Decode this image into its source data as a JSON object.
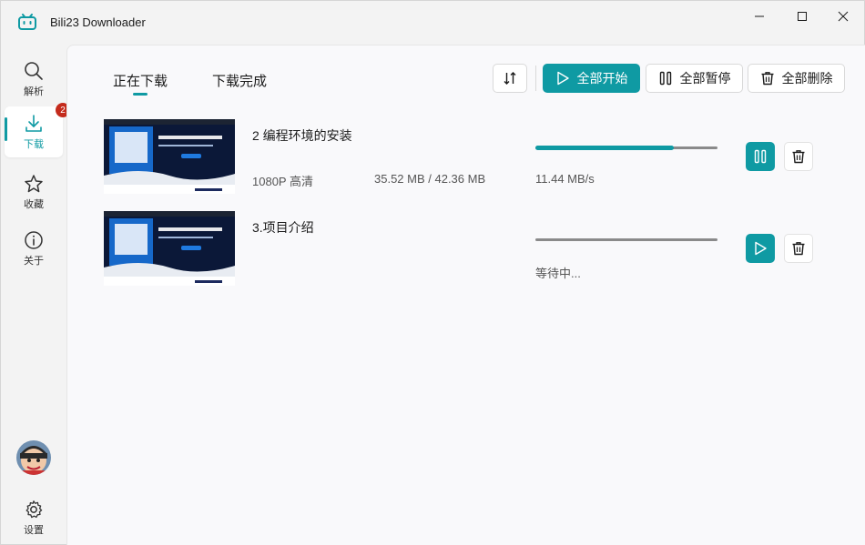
{
  "app": {
    "title": "Bili23 Downloader"
  },
  "window_controls": {
    "minimize": "minimize-icon",
    "maximize": "maximize-icon",
    "close": "close-icon"
  },
  "sidebar": {
    "items": [
      {
        "label": "解析",
        "icon": "search-icon"
      },
      {
        "label": "下载",
        "icon": "download-icon",
        "badge": "2"
      },
      {
        "label": "收藏",
        "icon": "star-icon"
      },
      {
        "label": "关于",
        "icon": "info-icon"
      }
    ],
    "settings_label": "设置"
  },
  "tabs": [
    {
      "label": "正在下载",
      "active": true
    },
    {
      "label": "下载完成",
      "active": false
    }
  ],
  "toolbar": {
    "sort_icon": "sort-icon",
    "start_all": "全部开始",
    "pause_all": "全部暂停",
    "delete_all": "全部删除"
  },
  "downloads": [
    {
      "title": "2 编程环境的安装",
      "quality": "1080P 高清",
      "size": "35.52 MB / 42.36 MB",
      "status": "11.44 MB/s",
      "progress": 0.76,
      "state": "downloading"
    },
    {
      "title": "3.项目介绍",
      "quality": "",
      "size": "",
      "status": "等待中...",
      "progress": 0,
      "state": "waiting"
    }
  ],
  "colors": {
    "accent": "#0f9aa3",
    "badge": "#c42b1c"
  }
}
